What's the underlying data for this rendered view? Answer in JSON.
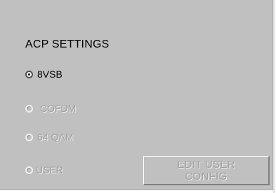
{
  "panel": {
    "title": "ACP SETTINGS",
    "options": [
      {
        "label": "8VSB",
        "selected": true,
        "enabled": true
      },
      {
        "label": "COFDM",
        "selected": false,
        "enabled": false
      },
      {
        "label": "64 QAM",
        "selected": false,
        "enabled": false
      },
      {
        "label": "USER",
        "selected": false,
        "enabled": false
      }
    ],
    "edit_button": {
      "label": "EDIT USER\nCONFIG",
      "enabled": false
    }
  },
  "colors": {
    "panel_bg": "#c0c0c0",
    "text": "#000000",
    "disabled_text": "#a0a0a0"
  }
}
